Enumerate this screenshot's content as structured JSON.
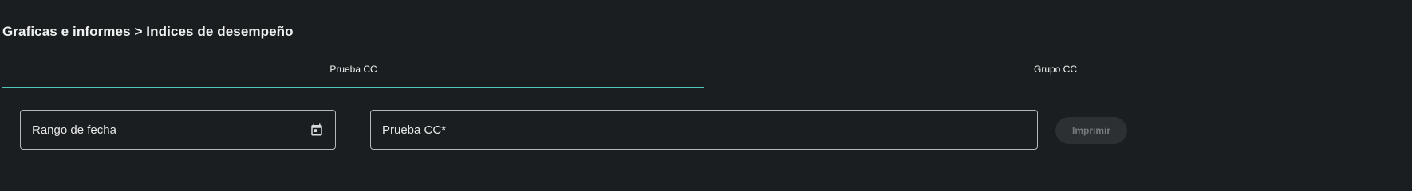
{
  "breadcrumb": {
    "text": "Graficas e informes > Indices de desempeño"
  },
  "tabs": [
    {
      "label": "Prueba CC",
      "active": true
    },
    {
      "label": "Grupo CC",
      "active": false
    }
  ],
  "filters": {
    "date_range": {
      "label": "Rango de fecha",
      "icon": "calendar-icon"
    },
    "prueba": {
      "label": "Prueba CC*"
    }
  },
  "actions": {
    "print_label": "Imprimir",
    "print_disabled": true
  },
  "colors": {
    "background": "#1b1e20",
    "accent": "#4fc6b9",
    "field_border": "#b4b8b9",
    "disabled_button_bg": "#2c3032",
    "disabled_button_text": "#757b7d"
  }
}
